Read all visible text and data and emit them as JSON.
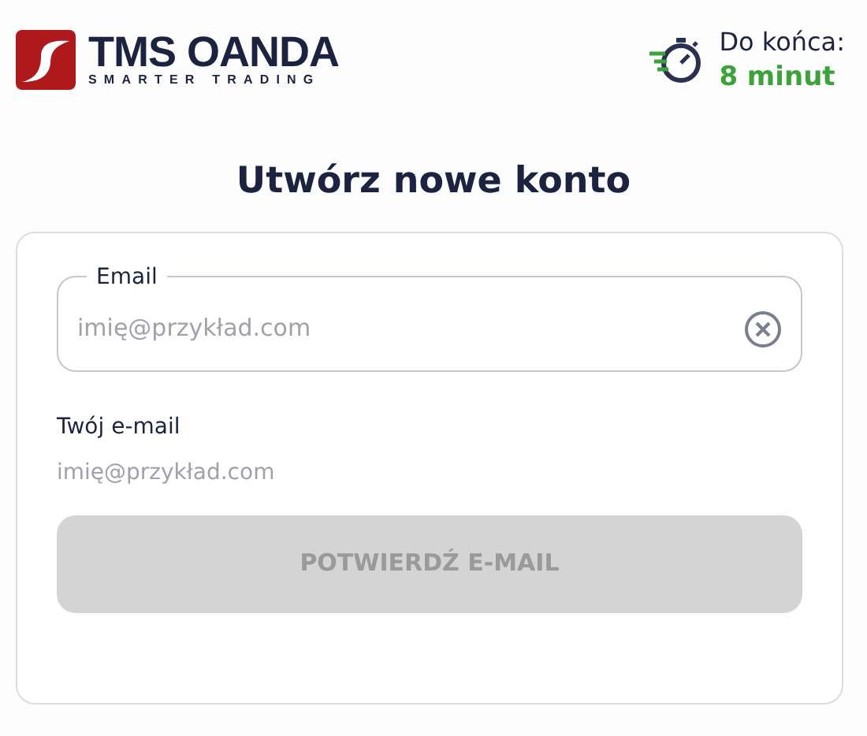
{
  "logo": {
    "name": "TMS OANDA",
    "tagline": "SMARTER TRADING"
  },
  "timer": {
    "label": "Do końca:",
    "value": "8 minut"
  },
  "title": "Utwórz nowe konto",
  "email_field": {
    "label": "Email",
    "placeholder": "imię@przykład.com"
  },
  "summary": {
    "label": "Twój e-mail",
    "value": "imię@przykład.com"
  },
  "confirm_button": {
    "label": "POTWIERDŹ E-MAIL",
    "disabled": true
  }
}
